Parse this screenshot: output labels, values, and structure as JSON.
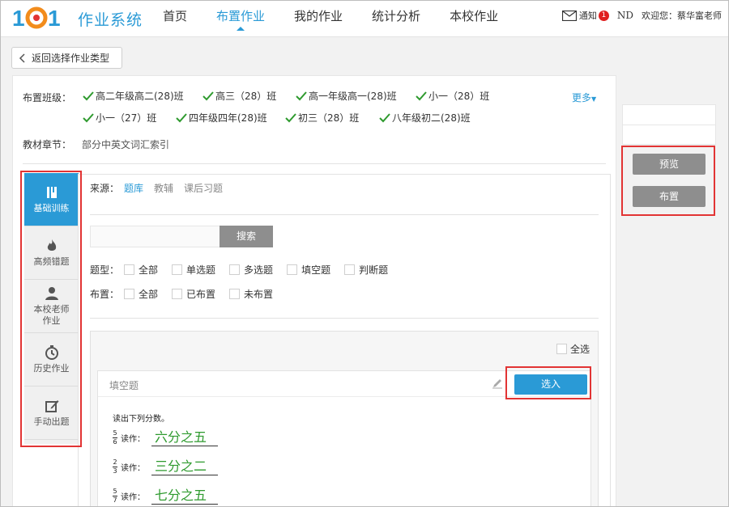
{
  "app": {
    "logo_text": "101",
    "system_title": "作业系统"
  },
  "nav": {
    "items": [
      {
        "label": "首页",
        "active": false
      },
      {
        "label": "布置作业",
        "active": true
      },
      {
        "label": "我的作业",
        "active": false
      },
      {
        "label": "统计分析",
        "active": false
      },
      {
        "label": "本校作业",
        "active": false
      }
    ]
  },
  "header_right": {
    "notice_label": "通知",
    "notice_count": "1",
    "nd_label": "ND",
    "welcome": "欢迎您：蔡华富老师"
  },
  "back_button": {
    "label": "返回选择作业类型"
  },
  "assign": {
    "class_label": "布置班级：",
    "classes": [
      "高二年级高二(28)班",
      "高三（28）班",
      "高一年级高一(28)班",
      "小一（28）班",
      "小一（27）班",
      "四年级四年(28)班",
      "初三（28）班",
      "八年级初二(28)班"
    ],
    "more_label": "更多",
    "chapter_label": "教材章节：",
    "chapter_value": "部分中英文词汇索引"
  },
  "side_tabs": [
    {
      "label": "基础训练",
      "icon": "book-icon",
      "active": true
    },
    {
      "label": "高频错题",
      "icon": "flame-icon",
      "active": false
    },
    {
      "label": "本校老师\n作业",
      "icon": "person-icon",
      "active": false
    },
    {
      "label": "历史作业",
      "icon": "clock-icon",
      "active": false
    },
    {
      "label": "手动出题",
      "icon": "edit-icon",
      "active": false
    }
  ],
  "source": {
    "label": "来源：",
    "options": [
      "题库",
      "教辅",
      "课后习题"
    ],
    "active": "题库"
  },
  "search": {
    "button_label": "搜索",
    "placeholder": ""
  },
  "filters": {
    "type_label": "题型：",
    "types": [
      "全部",
      "单选题",
      "多选题",
      "填空题",
      "判断题"
    ],
    "assign_label": "布置：",
    "assign_states": [
      "全部",
      "已布置",
      "未布置"
    ]
  },
  "question_list": {
    "select_all_label": "全选",
    "question": {
      "type_label": "填空题",
      "pick_button_label": "选入",
      "stem": "读出下列分数。",
      "read_label": "读作：",
      "items": [
        {
          "numerator": "5",
          "denominator": "6",
          "answer": "六分之五"
        },
        {
          "numerator": "2",
          "denominator": "3",
          "answer": "三分之二"
        },
        {
          "numerator": "5",
          "denominator": "7",
          "answer": "七分之五"
        }
      ]
    }
  },
  "right_panel": {
    "preview_label": "预览",
    "assign_label": "布置"
  },
  "colors": {
    "accent": "#2a9ad6",
    "highlight": "#e23434",
    "answer_green": "#2e9a2e",
    "button_gray": "#8e8e8e"
  }
}
